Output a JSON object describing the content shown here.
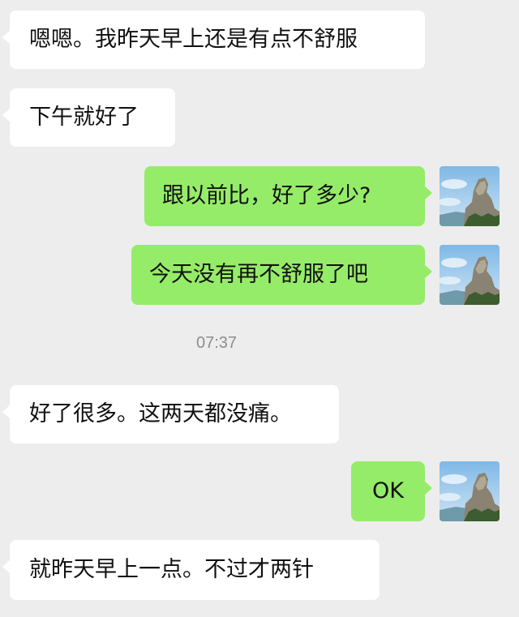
{
  "messages": [
    {
      "id": "m1",
      "side": "incoming",
      "text": "嗯嗯。我昨天早上还是有点不舒服"
    },
    {
      "id": "m2",
      "side": "incoming",
      "text": "下午就好了"
    },
    {
      "id": "m3",
      "side": "outgoing",
      "text": "跟以前比，好了多少?"
    },
    {
      "id": "m4",
      "side": "outgoing",
      "text": "今天没有再不舒服了吧"
    },
    {
      "id": "m5",
      "side": "incoming",
      "text": "好了很多。这两天都没痛。"
    },
    {
      "id": "m6",
      "side": "outgoing",
      "text": "OK"
    },
    {
      "id": "m7",
      "side": "incoming",
      "text": "就昨天早上一点。不过才两针"
    }
  ],
  "timestamp": "07:37",
  "colors": {
    "background": "#ededed",
    "incoming_bubble": "#ffffff",
    "outgoing_bubble": "#95ec69",
    "text": "#111111",
    "timestamp": "#8d8d8d"
  },
  "avatar_icon": "mountain-rock-photo"
}
